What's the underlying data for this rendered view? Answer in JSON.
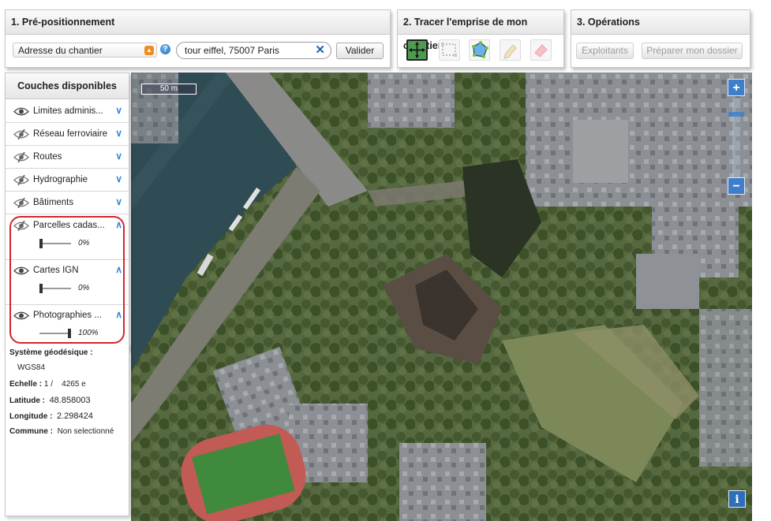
{
  "panel1": {
    "title": "1. Pré-positionnement",
    "select_value": "Adresse du chantier",
    "search_value": "tour eiffel, 75007 Paris",
    "search_placeholder": "Adresse",
    "validate_label": "Valider"
  },
  "panel2": {
    "title": "2. Tracer l'emprise de mon chantier",
    "tools": [
      "pan-tool",
      "rectangle-tool",
      "polygon-tool",
      "edit-tool",
      "erase-tool"
    ]
  },
  "panel3": {
    "title": "3. Opérations",
    "exploitants_label": "Exploitants",
    "preparer_label": "Préparer mon dossier"
  },
  "layers": {
    "title": "Couches disponibles",
    "items": [
      {
        "label": "Limites adminis...",
        "visible": true,
        "expanded": false
      },
      {
        "label": "Réseau ferroviaire",
        "visible": false,
        "expanded": false
      },
      {
        "label": "Routes",
        "visible": false,
        "expanded": false
      },
      {
        "label": "Hydrographie",
        "visible": false,
        "expanded": false
      },
      {
        "label": "Bâtiments",
        "visible": false,
        "expanded": false
      },
      {
        "label": "Parcelles cadas...",
        "visible": false,
        "expanded": true,
        "opacity": "0%",
        "opacity_value": 0
      },
      {
        "label": "Cartes IGN",
        "visible": true,
        "expanded": true,
        "opacity": "0%",
        "opacity_value": 0
      },
      {
        "label": "Photographies ...",
        "visible": true,
        "expanded": true,
        "opacity": "100%",
        "opacity_value": 100
      }
    ]
  },
  "info": {
    "systeme_label": "Système géodésique :",
    "systeme_value": "WGS84",
    "echelle_label": "Echelle :",
    "echelle_value": "1 /    4265 e",
    "latitude_label": "Latitude :",
    "latitude_value": "48.858003",
    "longitude_label": "Longitude :",
    "longitude_value": "2.298424",
    "commune_label": "Commune :",
    "commune_value": "Non selectionné"
  },
  "map": {
    "scale_label": "50 m",
    "zoom_in": "+",
    "zoom_out": "−",
    "info_button": "i"
  },
  "colors": {
    "accent": "#3f7fc9",
    "highlight_outline": "#d4262c",
    "active_tool": "#4e9a50"
  }
}
